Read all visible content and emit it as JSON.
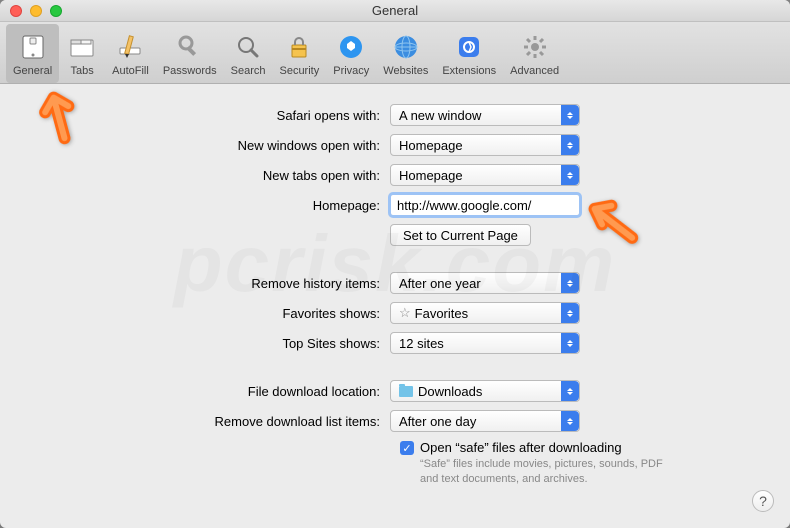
{
  "window_title": "General",
  "toolbar": {
    "items": [
      {
        "key": "general",
        "label": "General",
        "active": true
      },
      {
        "key": "tabs",
        "label": "Tabs"
      },
      {
        "key": "autofill",
        "label": "AutoFill"
      },
      {
        "key": "passwords",
        "label": "Passwords"
      },
      {
        "key": "search",
        "label": "Search"
      },
      {
        "key": "security",
        "label": "Security"
      },
      {
        "key": "privacy",
        "label": "Privacy"
      },
      {
        "key": "websites",
        "label": "Websites"
      },
      {
        "key": "extensions",
        "label": "Extensions"
      },
      {
        "key": "advanced",
        "label": "Advanced"
      }
    ]
  },
  "settings": {
    "opens_with": {
      "label": "Safari opens with:",
      "value": "A new window"
    },
    "new_windows": {
      "label": "New windows open with:",
      "value": "Homepage"
    },
    "new_tabs": {
      "label": "New tabs open with:",
      "value": "Homepage"
    },
    "homepage": {
      "label": "Homepage:",
      "value": "http://www.google.com/"
    },
    "set_current": "Set to Current Page",
    "remove_history": {
      "label": "Remove history items:",
      "value": "After one year"
    },
    "favorites_shows": {
      "label": "Favorites shows:",
      "value": "Favorites"
    },
    "top_sites": {
      "label": "Top Sites shows:",
      "value": "12 sites"
    },
    "download_location": {
      "label": "File download location:",
      "value": "Downloads"
    },
    "remove_downloads": {
      "label": "Remove download list items:",
      "value": "After one day"
    },
    "open_safe": {
      "label": "Open “safe” files after downloading",
      "checked": true
    },
    "safe_hint": "“Safe” files include movies, pictures, sounds, PDF and text documents, and archives."
  },
  "colors": {
    "accent": "#3b7ded",
    "arrow": "#ff6a13"
  }
}
